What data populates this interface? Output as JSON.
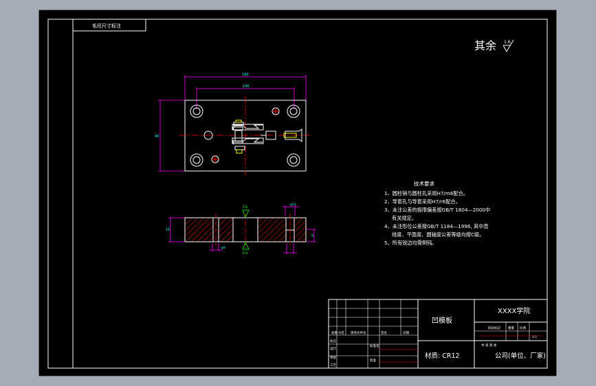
{
  "corner_label": "毛坯尺寸标注",
  "roughness_note": {
    "prefix": "其余",
    "value": "1.6"
  },
  "dimensions": {
    "overall_length": "180",
    "hole_spacing": "140",
    "width": "90",
    "thickness": "15",
    "pocket_depth": "5",
    "hole_dia_a": "φ9",
    "hole_dia_b": "φ11",
    "roughness_top": "0.8",
    "roughness_bottom": "0.8"
  },
  "tech_requirements": {
    "title": "技术要求",
    "items": [
      "1、圆柱销与圆柱孔采用H7/m6配合。",
      "2、导套孔与导套采用H7/r6配合。",
      "3、未注公差的极限偏差按GB/T 1804—2000中",
      "有关规定。",
      "4、未注形位公差按GB/T 1184—1996, 其中直",
      "线度、平面度、圆轴度公差等级均按C级。",
      "5、所有锐边均需倒钝。"
    ]
  },
  "title_block": {
    "part_name": "凹模板",
    "school": "XXXX学院",
    "material": "材质: CR12",
    "company": "公司(单位、厂家)",
    "row_labels": [
      "标记",
      "设计",
      "审核",
      "工艺"
    ],
    "col_labels": [
      "处数",
      "分区",
      "更改文件号",
      "签名",
      "日期"
    ],
    "std_label": "标准化",
    "approve_label": "批准",
    "stage_label": "阶段标记",
    "weight_label": "重量",
    "scale_label": "比例",
    "scale_value": "1:1",
    "sheet_label": "共 张 第 张"
  },
  "colors": {
    "background": "#000000",
    "frame": "#ffffff",
    "outline": "#ffffff",
    "centerline": "#ff0000",
    "dimension": "#ff00ff",
    "dimension_text": "#00ffff",
    "hatch": "#ff0000",
    "symbol": "#00ff00",
    "part_detail": "#ffff00",
    "outer_border": "#c0c0c0"
  }
}
